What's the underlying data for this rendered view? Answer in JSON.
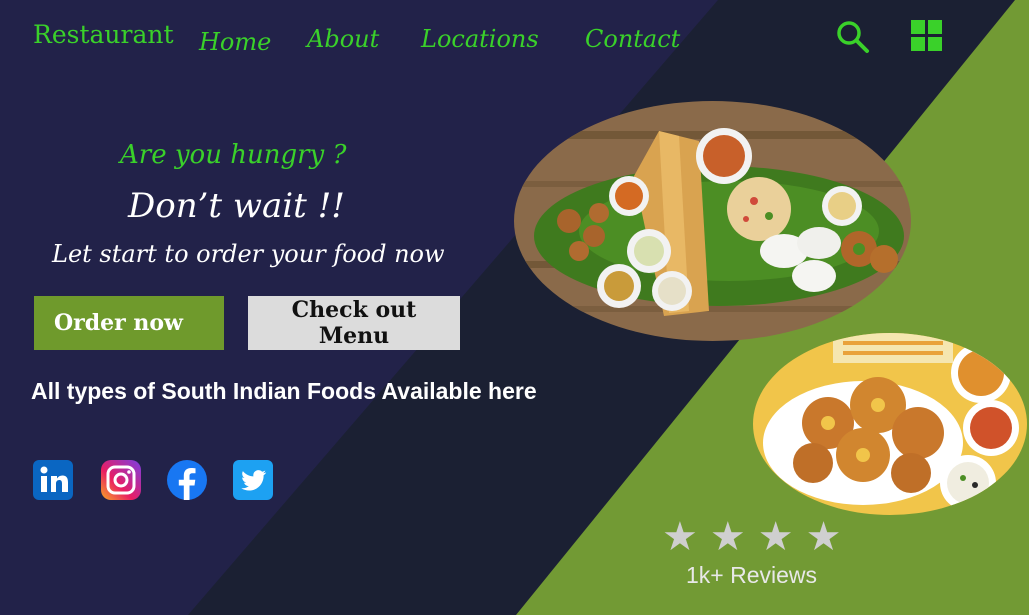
{
  "brand": "Restaurant",
  "nav": {
    "home": "Home",
    "about": "About",
    "locations": "Locations",
    "contact": "Contact"
  },
  "icons": [
    "search-icon",
    "grid-menu-icon",
    "linkedin-icon",
    "instagram-icon",
    "facebook-icon",
    "twitter-icon",
    "star-icon"
  ],
  "hero": {
    "question": "Are you hungry ?",
    "headline": "Don’t wait !!",
    "subline": "Let start to order your food now"
  },
  "buttons": {
    "order": "Order now",
    "menu": "Check out Menu"
  },
  "tagline": "All types of South Indian Foods Available here",
  "rating": {
    "stars": 4,
    "reviews": "1k+ Reviews"
  },
  "colors": {
    "navy": "#222249",
    "dark": "#1b2033",
    "olive": "#729a34",
    "accent": "#3ad12a"
  }
}
